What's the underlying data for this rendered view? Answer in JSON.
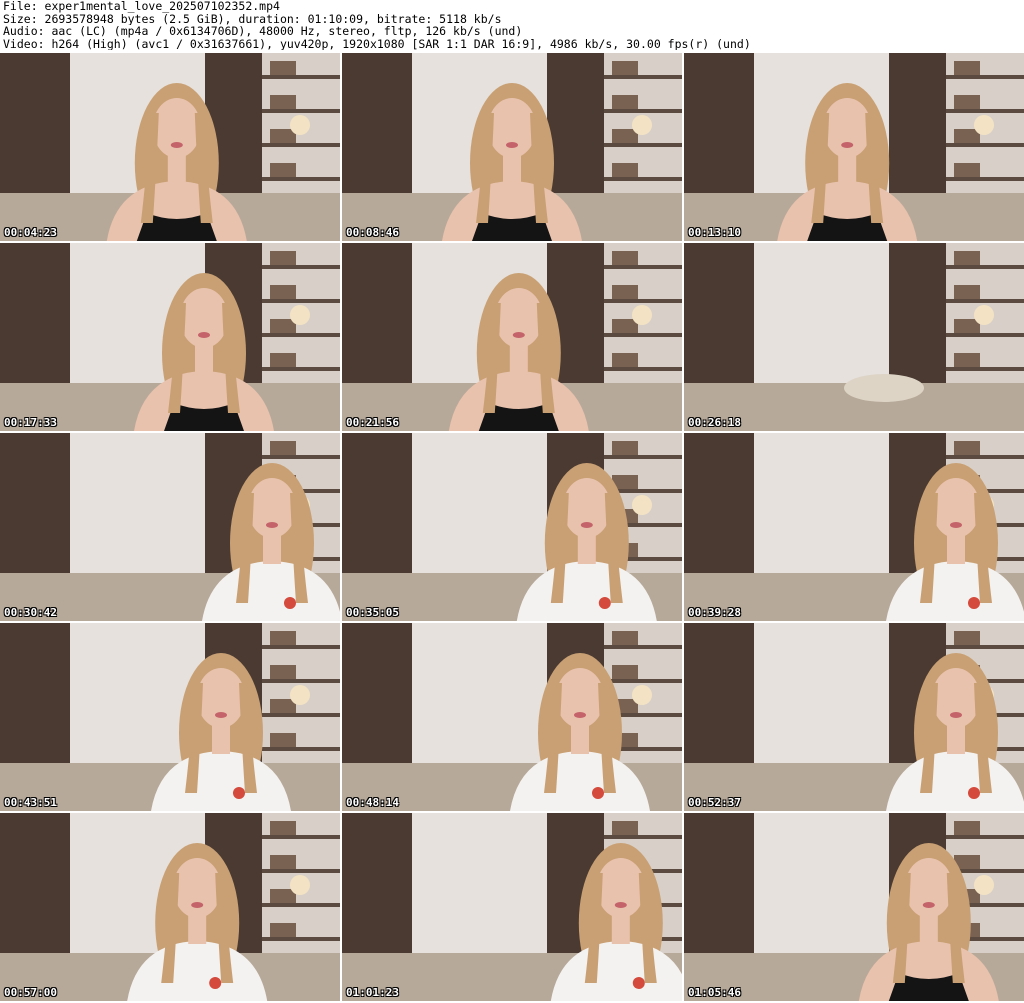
{
  "header": {
    "file_line": "File: exper1mental_love_202507102352.mp4",
    "size_line": "Size: 2693578948 bytes (2.5 GiB), duration: 01:10:09, bitrate: 5118 kb/s",
    "audio_line": "Audio: aac (LC) (mp4a / 0x6134706D), 48000 Hz, stereo, fltp, 126 kb/s (und)",
    "video_line": "Video: h264 (High) (avc1 / 0x31637661), yuv420p, 1920x1080 [SAR 1:1 DAR 16:9], 4986 kb/s, 30.00 fps(r) (und)"
  },
  "thumbnails": [
    {
      "timestamp": "00:04:23",
      "top": "black"
    },
    {
      "timestamp": "00:08:46",
      "top": "black"
    },
    {
      "timestamp": "00:13:10",
      "top": "black"
    },
    {
      "timestamp": "00:17:33",
      "top": "black"
    },
    {
      "timestamp": "00:21:56",
      "top": "black"
    },
    {
      "timestamp": "00:26:18",
      "top": "none"
    },
    {
      "timestamp": "00:30:42",
      "top": "white"
    },
    {
      "timestamp": "00:35:05",
      "top": "white"
    },
    {
      "timestamp": "00:39:28",
      "top": "white"
    },
    {
      "timestamp": "00:43:51",
      "top": "white"
    },
    {
      "timestamp": "00:48:14",
      "top": "white"
    },
    {
      "timestamp": "00:52:37",
      "top": "white"
    },
    {
      "timestamp": "00:57:00",
      "top": "white"
    },
    {
      "timestamp": "01:01:23",
      "top": "white"
    },
    {
      "timestamp": "01:05:46",
      "top": "black"
    }
  ],
  "colors": {
    "wall": "#cfc8c2",
    "curtain_dark": "#4a3a32",
    "curtain_light": "#e6e1dc",
    "sofa": "#b7a999",
    "shelf": "#5b4a40",
    "hair": "#c9a074",
    "skin": "#e8c2ad",
    "top_black": "#141414",
    "top_white": "#f4f2f0",
    "logo_red": "#d44a3c",
    "timestamp_text": "#ffffff"
  }
}
